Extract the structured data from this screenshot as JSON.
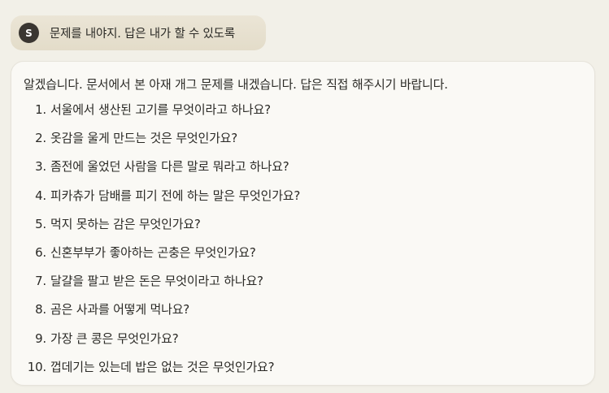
{
  "user_message": {
    "avatar_initial": "S",
    "text": "문제를 내야지. 답은 내가 할 수 있도록"
  },
  "assistant_reply": {
    "intro": "알겠습니다. 문서에서 본 아재 개그 문제를 내겠습니다. 답은 직접 해주시기 바랍니다.",
    "questions": [
      {
        "number": "1.",
        "text": "서울에서 생산된 고기를 무엇이라고 하나요?"
      },
      {
        "number": "2.",
        "text": "옷감을 울게 만드는 것은 무엇인가요?"
      },
      {
        "number": "3.",
        "text": "좀전에 울었던 사람을 다른 말로 뭐라고 하나요?"
      },
      {
        "number": "4.",
        "text": "피카츄가 담배를 피기 전에 하는 말은 무엇인가요?"
      },
      {
        "number": "5.",
        "text": "먹지 못하는 감은 무엇인가요?"
      },
      {
        "number": "6.",
        "text": "신혼부부가 좋아하는 곤충은 무엇인가요?"
      },
      {
        "number": "7.",
        "text": "달걀을 팔고 받은 돈은 무엇이라고 하나요?"
      },
      {
        "number": "8.",
        "text": "곰은 사과를 어떻게 먹나요?"
      },
      {
        "number": "9.",
        "text": "가장 큰 콩은 무엇인가요?"
      },
      {
        "number": "10.",
        "text": "껍데기는 있는데 밥은 없는 것은 무엇인가요?"
      }
    ]
  },
  "colors": {
    "page_background": "#f2f0e8",
    "user_bubble": "#e8e1d0",
    "avatar": "#3a3631",
    "card_background": "#faf9f5",
    "text": "#2b2a26"
  }
}
